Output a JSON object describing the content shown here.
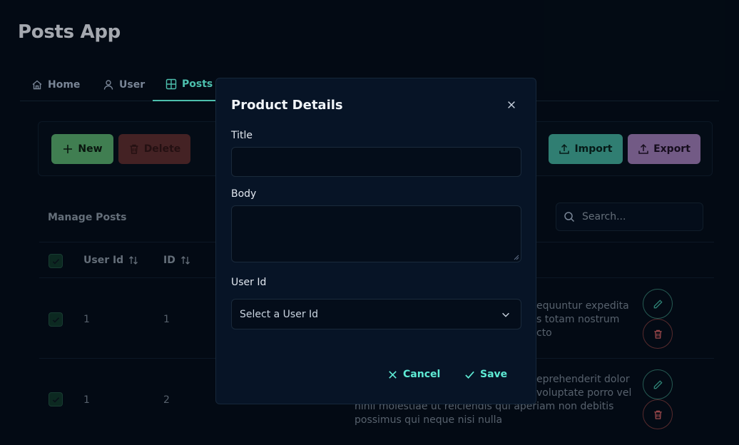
{
  "app": {
    "title": "Posts App"
  },
  "tabs": [
    {
      "label": "Home",
      "icon": "home-icon"
    },
    {
      "label": "User",
      "icon": "user-icon"
    },
    {
      "label": "Posts",
      "icon": "table-icon",
      "active": true
    }
  ],
  "toolbar": {
    "new_label": "New",
    "delete_label": "Delete",
    "import_label": "Import",
    "export_label": "Export"
  },
  "table": {
    "title": "Manage Posts",
    "search_placeholder": "Search...",
    "columns": [
      {
        "label": "User Id",
        "sortable": true
      },
      {
        "label": "ID",
        "sortable": true
      }
    ],
    "rows": [
      {
        "user_id": "1",
        "id": "1",
        "body_lines": [
          "equuntur expedita",
          "s totam nostrum",
          "cto"
        ]
      },
      {
        "user_id": "1",
        "id": "2",
        "body_lines": [
          "eprehenderit dolor",
          "voluptate porro vel",
          "nihil molestiae ut reiciendis qui aperiam non debitis",
          "possimus qui neque nisi nulla"
        ]
      }
    ]
  },
  "dialog": {
    "title": "Product Details",
    "fields": {
      "title_label": "Title",
      "title_value": "",
      "body_label": "Body",
      "body_value": "",
      "user_id_label": "User Id",
      "user_id_placeholder": "Select a User Id"
    },
    "cancel_label": "Cancel",
    "save_label": "Save"
  },
  "colors": {
    "background": "#040d19",
    "accent": "#5eead4",
    "new_button": "#4f9a63",
    "delete_button": "#542a2c",
    "import_button": "#3b9a8c",
    "export_button": "#8b6ea3",
    "dialog_bg": "#071426"
  }
}
